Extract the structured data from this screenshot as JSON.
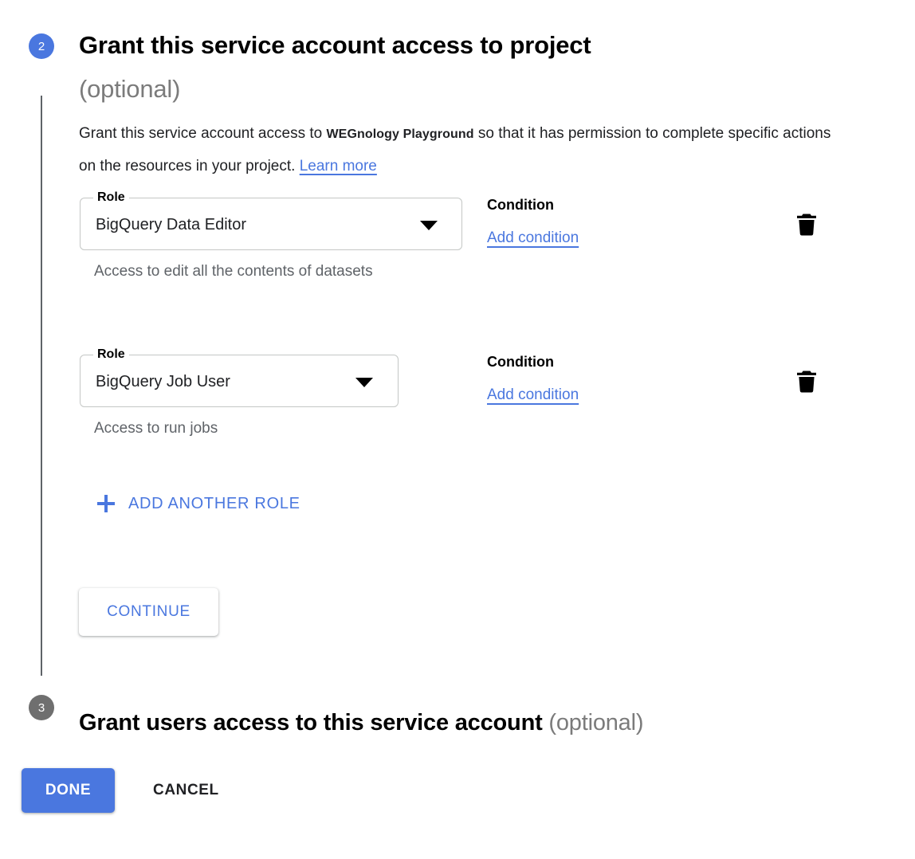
{
  "colors": {
    "accent_blue": "#4a77df",
    "step_inactive_gray": "#6f6f6f",
    "muted_text": "#5f6368",
    "optional_gray": "#7b7b7b"
  },
  "step2": {
    "number": "2",
    "title": "Grant this service account access to project",
    "optional": "(optional)",
    "description_before": "Grant this service account access to",
    "project_name": "WEGnology Playground",
    "description_after": "so that it has permission to complete specific actions on the resources in your project.",
    "learn_more": "Learn more",
    "roles": [
      {
        "legend": "Role",
        "value": "BigQuery Data Editor",
        "help": "Access to edit all the contents of datasets",
        "condition_label": "Condition",
        "add_condition": "Add condition",
        "delete_icon": "trash-icon",
        "dropdown_icon": "chevron-down-icon"
      },
      {
        "legend": "Role",
        "value": "BigQuery Job User",
        "help": "Access to run jobs",
        "condition_label": "Condition",
        "add_condition": "Add condition",
        "delete_icon": "trash-icon",
        "dropdown_icon": "chevron-down-icon"
      }
    ],
    "add_another_role": "ADD ANOTHER ROLE",
    "add_icon": "plus-icon",
    "continue_label": "CONTINUE"
  },
  "step3": {
    "number": "3",
    "title": "Grant users access to this service account",
    "optional": "(optional)"
  },
  "footer": {
    "done_label": "DONE",
    "cancel_label": "CANCEL"
  }
}
